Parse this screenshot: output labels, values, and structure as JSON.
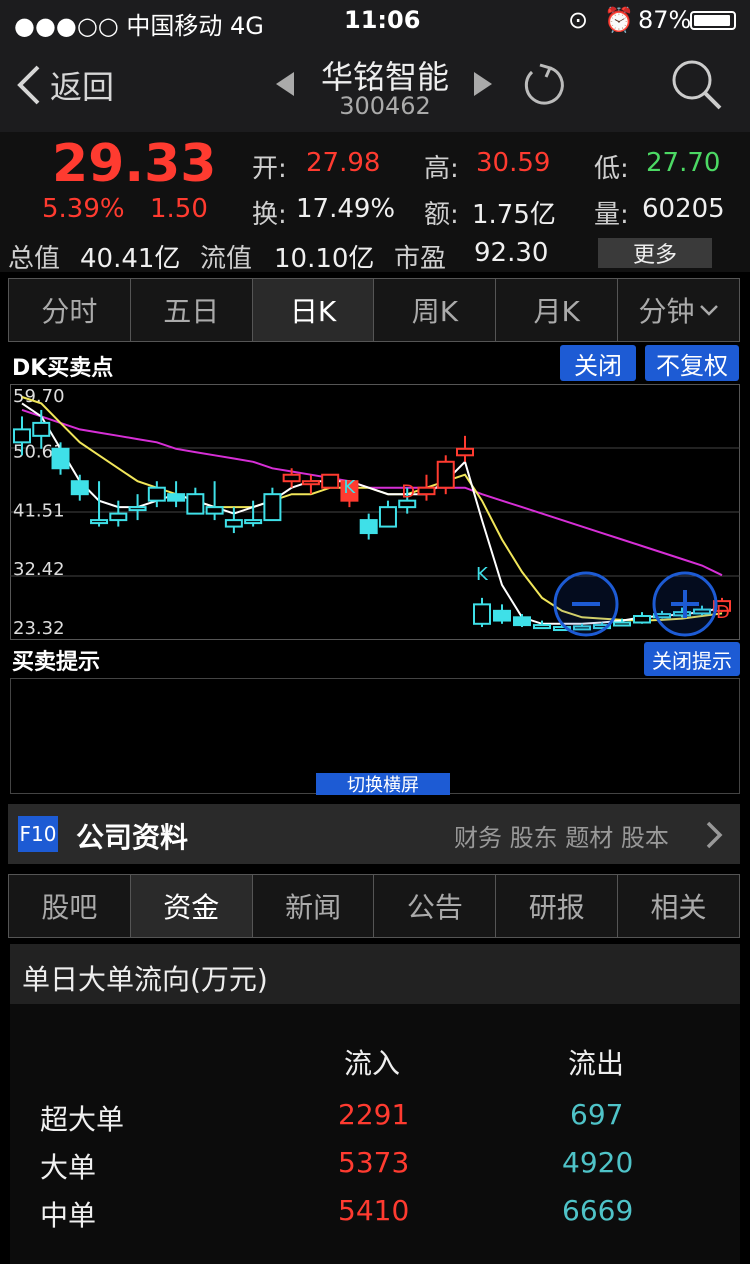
{
  "status": {
    "carrier": "●●●○○ 中国移动  4G",
    "time": "11:06",
    "battery": "87%"
  },
  "nav": {
    "back": "返回",
    "stock_name": "华铭智能",
    "stock_code": "300462"
  },
  "quote": {
    "price": "29.33",
    "pct": "5.39%",
    "change": "1.50",
    "open_label": "开:",
    "open": "27.98",
    "high_label": "高:",
    "high": "30.59",
    "low_label": "低:",
    "low": "27.70",
    "turnover_label": "换:",
    "turnover": "17.49%",
    "amount_label": "额:",
    "amount": "1.75亿",
    "volume_label": "量:",
    "volume": "60205",
    "mcap_label": "总值",
    "mcap": "40.41亿",
    "float_label": "流值",
    "float": "10.10亿",
    "pe_label": "市盈",
    "pe": "92.30",
    "more": "更多"
  },
  "chart_tabs": [
    "分时",
    "五日",
    "日K",
    "周K",
    "月K",
    "分钟"
  ],
  "chart_header": {
    "title": "DK买卖点",
    "close_btn": "关闭",
    "adjust_btn": "不复权"
  },
  "chart_data": {
    "type": "candlestick",
    "y_ticks": [
      "59.70",
      "50.61",
      "41.51",
      "32.42",
      "23.32"
    ],
    "ylim": [
      23.32,
      59.7
    ],
    "annotations": [
      {
        "label": "K",
        "color": "cyan"
      },
      {
        "label": "D",
        "color": "red"
      },
      {
        "label": "K",
        "color": "cyan"
      },
      {
        "label": "D",
        "color": "red"
      }
    ],
    "candles": [
      {
        "o": 52,
        "c": 54,
        "h": 56,
        "l": 50,
        "up": false
      },
      {
        "o": 53,
        "c": 55,
        "h": 57,
        "l": 51,
        "up": false
      },
      {
        "o": 51,
        "c": 48,
        "h": 52,
        "l": 47,
        "up": false
      },
      {
        "o": 44,
        "c": 46,
        "h": 47,
        "l": 43,
        "up": false
      },
      {
        "o": 40,
        "c": 40,
        "h": 46,
        "l": 39,
        "up": false
      },
      {
        "o": 40,
        "c": 41,
        "h": 43,
        "l": 39,
        "up": false
      },
      {
        "o": 42,
        "c": 42,
        "h": 44,
        "l": 40,
        "up": false
      },
      {
        "o": 43,
        "c": 45,
        "h": 46,
        "l": 42,
        "up": false
      },
      {
        "o": 43,
        "c": 44,
        "h": 46,
        "l": 42,
        "up": false
      },
      {
        "o": 41,
        "c": 44,
        "h": 45,
        "l": 41,
        "up": false
      },
      {
        "o": 42,
        "c": 41,
        "h": 46,
        "l": 40,
        "up": false
      },
      {
        "o": 40,
        "c": 39,
        "h": 42,
        "l": 38,
        "up": false
      },
      {
        "o": 40,
        "c": 40,
        "h": 43,
        "l": 39,
        "up": false
      },
      {
        "o": 40,
        "c": 44,
        "h": 45,
        "l": 40,
        "up": false
      },
      {
        "o": 46,
        "c": 47,
        "h": 48,
        "l": 45,
        "up": true
      },
      {
        "o": 46,
        "c": 46,
        "h": 47,
        "l": 44,
        "up": true
      },
      {
        "o": 45,
        "c": 47,
        "h": 47,
        "l": 45,
        "up": true
      },
      {
        "o": 46,
        "c": 43,
        "h": 46,
        "l": 42,
        "up": true
      },
      {
        "o": 40,
        "c": 38,
        "h": 41,
        "l": 37,
        "up": false
      },
      {
        "o": 39,
        "c": 42,
        "h": 43,
        "l": 39,
        "up": false
      },
      {
        "o": 42,
        "c": 43,
        "h": 45,
        "l": 41,
        "up": false
      },
      {
        "o": 44,
        "c": 45,
        "h": 47,
        "l": 43,
        "up": true
      },
      {
        "o": 45,
        "c": 49,
        "h": 50,
        "l": 44,
        "up": true
      },
      {
        "o": 50,
        "c": 51,
        "h": 53,
        "l": 49,
        "up": true
      },
      {
        "o": 24,
        "c": 27,
        "h": 28,
        "l": 23.5,
        "up": false
      },
      {
        "o": 26,
        "c": 24.5,
        "h": 27,
        "l": 24,
        "up": false
      },
      {
        "o": 25,
        "c": 23.8,
        "h": 25.5,
        "l": 23.5,
        "up": false
      },
      {
        "o": 23.8,
        "c": 23.5,
        "h": 24.5,
        "l": 23.3,
        "up": false
      },
      {
        "o": 23.5,
        "c": 23.4,
        "h": 24,
        "l": 23.2,
        "up": false
      },
      {
        "o": 23.4,
        "c": 23.6,
        "h": 24,
        "l": 23.3,
        "up": false
      },
      {
        "o": 23.6,
        "c": 23.8,
        "h": 24.2,
        "l": 23.5,
        "up": false
      },
      {
        "o": 23.8,
        "c": 24.2,
        "h": 24.8,
        "l": 23.7,
        "up": false
      },
      {
        "o": 24.2,
        "c": 25.2,
        "h": 25.8,
        "l": 24,
        "up": false
      },
      {
        "o": 25.0,
        "c": 25.5,
        "h": 26,
        "l": 24.8,
        "up": false
      },
      {
        "o": 25.3,
        "c": 25.8,
        "h": 26.5,
        "l": 25,
        "up": false
      },
      {
        "o": 25.6,
        "c": 26.2,
        "h": 26.8,
        "l": 25.3,
        "up": false
      },
      {
        "o": 26,
        "c": 27.5,
        "h": 28,
        "l": 25.8,
        "up": true
      }
    ],
    "ma_white": [
      58,
      56,
      51,
      46,
      43,
      42,
      42,
      43,
      44,
      43,
      42,
      41,
      42,
      43,
      45,
      46,
      46,
      46,
      45,
      44,
      44,
      44,
      46,
      49,
      40,
      30,
      25,
      24,
      24,
      24,
      24.2,
      24.5,
      25,
      25.2,
      25.5,
      25.8,
      26.5
    ],
    "ma_yellow": [
      59,
      58,
      55,
      52,
      50,
      48,
      46,
      45,
      44,
      43,
      42,
      42,
      42,
      43,
      44,
      44,
      45,
      45,
      45,
      44,
      44,
      45,
      46,
      47,
      43,
      37,
      32,
      28,
      26,
      25,
      24.8,
      24.6,
      24.5,
      24.6,
      24.8,
      25.2,
      25.6
    ],
    "ma_magenta": [
      57,
      56,
      55,
      54,
      53.5,
      53,
      52.5,
      52,
      51,
      50.5,
      50,
      49.5,
      49,
      48,
      47.5,
      47,
      46.5,
      46,
      45,
      45,
      45,
      45,
      45,
      45,
      44,
      43,
      42,
      41,
      40,
      39,
      38,
      37,
      36,
      35,
      34,
      33,
      31.5
    ]
  },
  "hint": {
    "title": "买卖提示",
    "close_btn": "关闭提示",
    "rotate_btn": "切换横屏"
  },
  "f10": {
    "badge": "F10",
    "title": "公司资料",
    "links": "财务 股东 题材 股本"
  },
  "info_tabs": [
    "股吧",
    "资金",
    "新闻",
    "公告",
    "研报",
    "相关"
  ],
  "money": {
    "title": "单日大单流向(万元)",
    "in_header": "流入",
    "out_header": "流出",
    "rows": [
      {
        "name": "超大单",
        "in": "2291",
        "out": "697"
      },
      {
        "name": "大单",
        "in": "5373",
        "out": "4920"
      },
      {
        "name": "中单",
        "in": "5410",
        "out": "6669"
      }
    ]
  }
}
